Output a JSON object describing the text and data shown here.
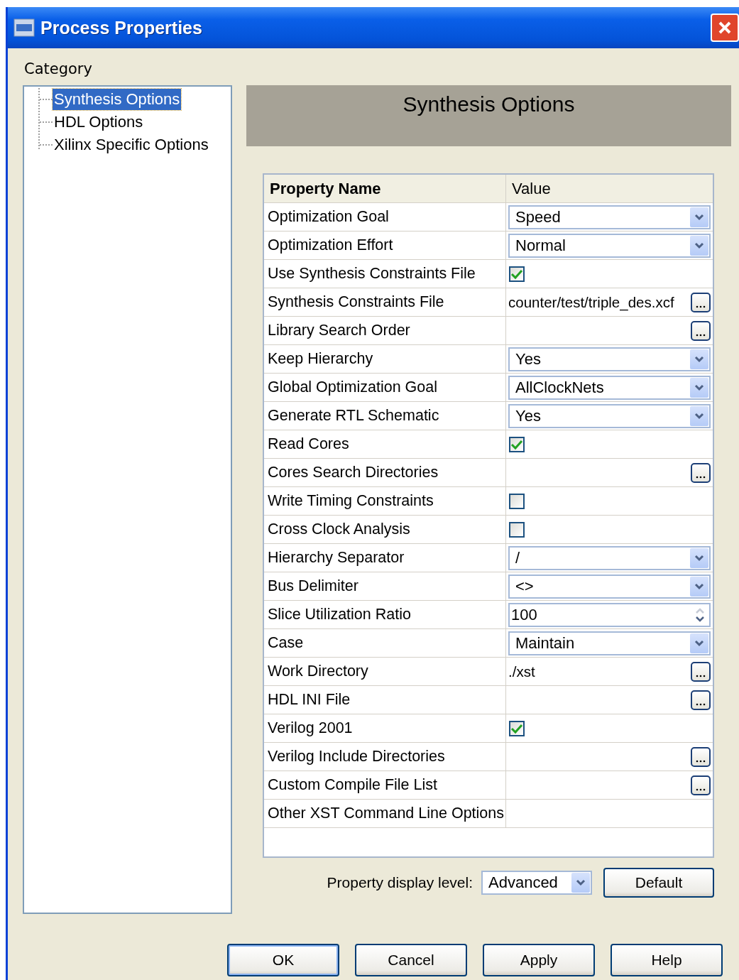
{
  "window": {
    "title": "Process Properties"
  },
  "category_label": "Category",
  "tree": {
    "items": [
      {
        "label": "Synthesis Options",
        "selected": true
      },
      {
        "label": "HDL Options",
        "selected": false
      },
      {
        "label": "Xilinx Specific Options",
        "selected": false
      }
    ]
  },
  "panel_title": "Synthesis Options",
  "table": {
    "columns": [
      "Property Name",
      "Value"
    ],
    "rows": [
      {
        "name": "Optimization Goal",
        "kind": "dropdown",
        "value": "Speed"
      },
      {
        "name": "Optimization Effort",
        "kind": "dropdown",
        "value": "Normal"
      },
      {
        "name": "Use Synthesis Constraints File",
        "kind": "checkbox",
        "checked": true
      },
      {
        "name": "Synthesis Constraints File",
        "kind": "browse",
        "value": "counter/test/triple_des.xcf"
      },
      {
        "name": "Library Search Order",
        "kind": "browse"
      },
      {
        "name": "Keep Hierarchy",
        "kind": "dropdown",
        "value": "Yes"
      },
      {
        "name": "Global Optimization Goal",
        "kind": "dropdown",
        "value": "AllClockNets"
      },
      {
        "name": "Generate RTL Schematic",
        "kind": "dropdown",
        "value": "Yes"
      },
      {
        "name": "Read Cores",
        "kind": "checkbox",
        "checked": true
      },
      {
        "name": "Cores Search Directories",
        "kind": "browse"
      },
      {
        "name": "Write Timing Constraints",
        "kind": "checkbox",
        "checked": false
      },
      {
        "name": "Cross Clock Analysis",
        "kind": "checkbox",
        "checked": false
      },
      {
        "name": "Hierarchy Separator",
        "kind": "dropdown",
        "value": "/"
      },
      {
        "name": "Bus Delimiter",
        "kind": "dropdown",
        "value": "<>"
      },
      {
        "name": "Slice Utilization Ratio",
        "kind": "spin",
        "value": "100"
      },
      {
        "name": "Case",
        "kind": "dropdown",
        "value": "Maintain"
      },
      {
        "name": "Work Directory",
        "kind": "browse",
        "value": "./xst"
      },
      {
        "name": "HDL INI File",
        "kind": "browse"
      },
      {
        "name": "Verilog 2001",
        "kind": "checkbox",
        "checked": true
      },
      {
        "name": "Verilog Include Directories",
        "kind": "browse"
      },
      {
        "name": "Custom Compile File List",
        "kind": "browse"
      },
      {
        "name": "Other XST Command Line Options",
        "kind": "text"
      }
    ]
  },
  "display_level": {
    "label": "Property display level:",
    "value": "Advanced"
  },
  "default_button": "Default",
  "footer_buttons": [
    {
      "label": "OK",
      "focused": true
    },
    {
      "label": "Cancel",
      "focused": false
    },
    {
      "label": "Apply",
      "focused": false
    },
    {
      "label": "Help",
      "focused": false
    }
  ]
}
